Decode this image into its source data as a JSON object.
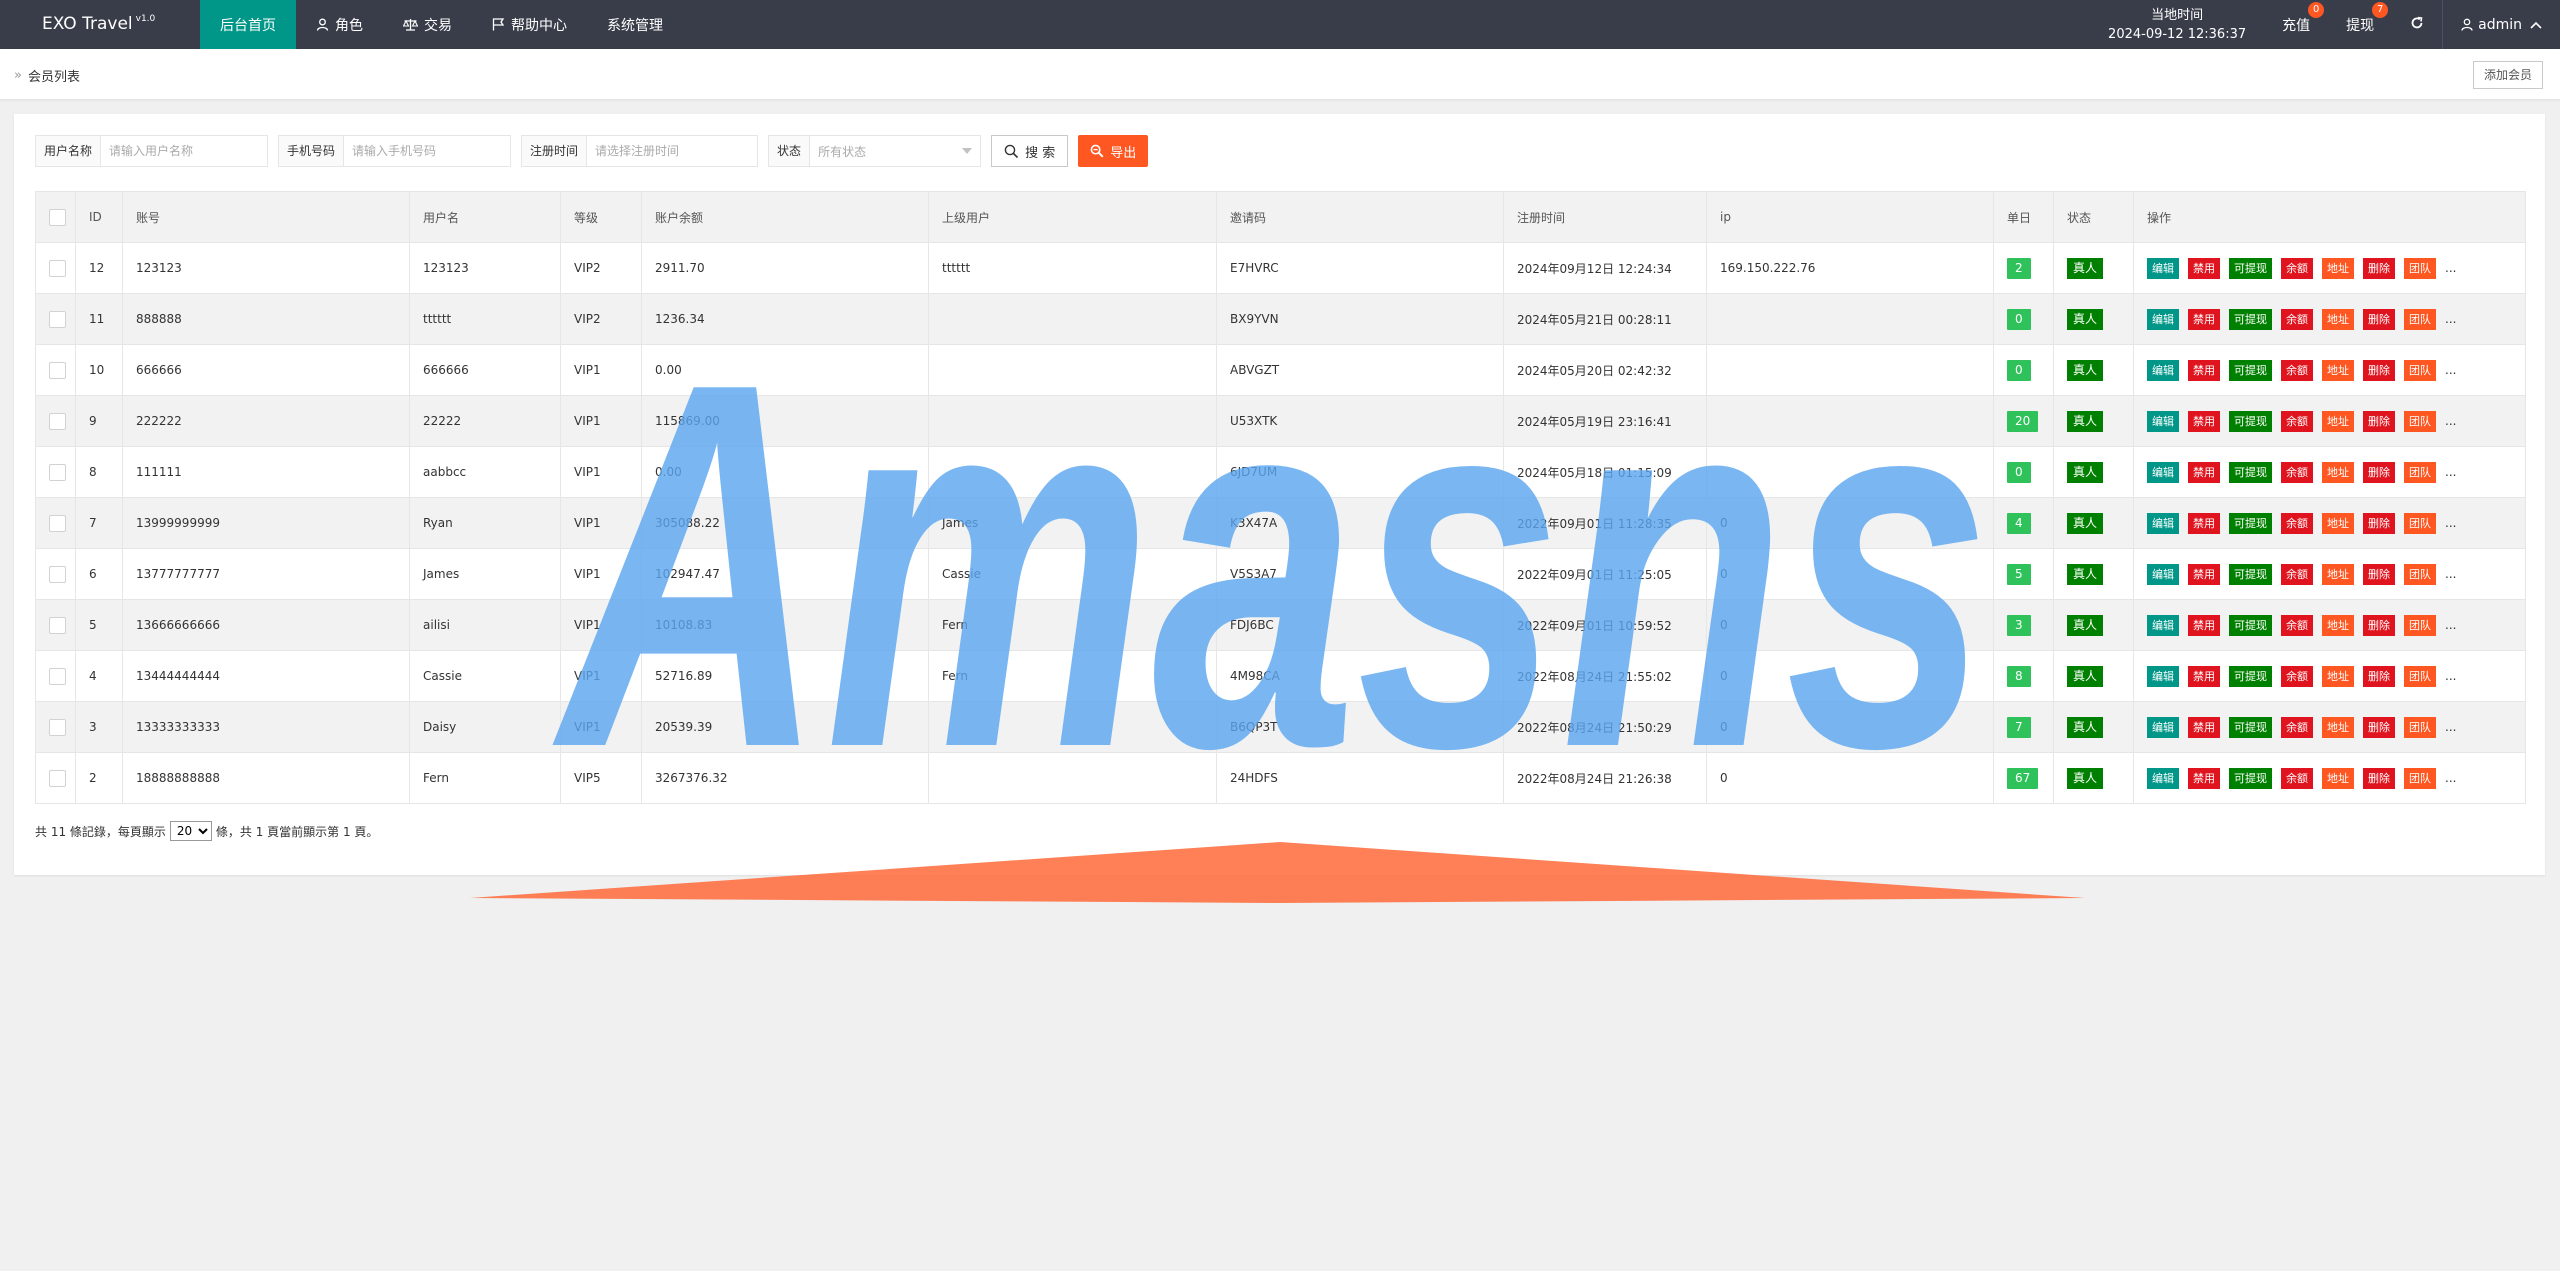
{
  "app": {
    "title": "EXO Travel",
    "version": "v1.0"
  },
  "nav": [
    {
      "label": "后台首页",
      "icon": "",
      "active": true
    },
    {
      "label": "角色",
      "icon": "user-icon"
    },
    {
      "label": "交易",
      "icon": "scale-icon"
    },
    {
      "label": "帮助中心",
      "icon": "flag-icon"
    },
    {
      "label": "系统管理",
      "icon": ""
    }
  ],
  "header_right": {
    "clock_label": "当地时间",
    "clock_value": "2024-09-12 12:36:37",
    "recharge_label": "充值",
    "recharge_count": "0",
    "withdraw_label": "提现",
    "withdraw_count": "7",
    "user_name": "admin"
  },
  "breadcrumb": {
    "label": "会员列表"
  },
  "add_member_label": "添加会员",
  "filters": {
    "username_label": "用户名称",
    "username_placeholder": "请输入用户名称",
    "phone_label": "手机号码",
    "phone_placeholder": "请输入手机号码",
    "regtime_label": "注册时间",
    "regtime_placeholder": "请选择注册时间",
    "status_label": "状态",
    "status_value": "所有状态",
    "search_label": "搜 索",
    "export_label": "导出"
  },
  "table": {
    "headers": [
      "ID",
      "账号",
      "用户名",
      "等级",
      "账户余额",
      "上级用户",
      "邀请码",
      "注册时间",
      "ip",
      "单日",
      "状态",
      "操作"
    ],
    "op_labels": [
      "编辑",
      "禁用",
      "可提现",
      "余额",
      "地址",
      "删除",
      "团队",
      "..."
    ],
    "rows": [
      {
        "id": "12",
        "account": "123123",
        "username": "123123",
        "level": "VIP2",
        "balance": "2911.70",
        "parent": "tttttt",
        "invite": "E7HVRC",
        "regtime": "2024年09月12日 12:24:34",
        "ip": "169.150.222.76",
        "daily": "2",
        "status": "真人"
      },
      {
        "id": "11",
        "account": "888888",
        "username": "tttttt",
        "level": "VIP2",
        "balance": "1236.34",
        "parent": "",
        "invite": "BX9YVN",
        "regtime": "2024年05月21日 00:28:11",
        "ip": "",
        "daily": "0",
        "status": "真人"
      },
      {
        "id": "10",
        "account": "666666",
        "username": "666666",
        "level": "VIP1",
        "balance": "0.00",
        "parent": "",
        "invite": "ABVGZT",
        "regtime": "2024年05月20日 02:42:32",
        "ip": "",
        "daily": "0",
        "status": "真人"
      },
      {
        "id": "9",
        "account": "222222",
        "username": "22222",
        "level": "VIP1",
        "balance": "115869.00",
        "parent": "",
        "invite": "U53XTK",
        "regtime": "2024年05月19日 23:16:41",
        "ip": "",
        "daily": "20",
        "status": "真人"
      },
      {
        "id": "8",
        "account": "111111",
        "username": "aabbcc",
        "level": "VIP1",
        "balance": "0.00",
        "parent": "",
        "invite": "6JD7UM",
        "regtime": "2024年05月18日 01:15:09",
        "ip": "",
        "daily": "0",
        "status": "真人"
      },
      {
        "id": "7",
        "account": "13999999999",
        "username": "Ryan",
        "level": "VIP1",
        "balance": "305088.22",
        "parent": "James",
        "invite": "K3X47A",
        "regtime": "2022年09月01日 11:28:35",
        "ip": "0",
        "daily": "4",
        "status": "真人"
      },
      {
        "id": "6",
        "account": "13777777777",
        "username": "James",
        "level": "VIP1",
        "balance": "102947.47",
        "parent": "Cassie",
        "invite": "V5S3A7",
        "regtime": "2022年09月01日 11:25:05",
        "ip": "0",
        "daily": "5",
        "status": "真人"
      },
      {
        "id": "5",
        "account": "13666666666",
        "username": "ailisi",
        "level": "VIP1",
        "balance": "10108.83",
        "parent": "Fern",
        "invite": "FDJ6BC",
        "regtime": "2022年09月01日 10:59:52",
        "ip": "0",
        "daily": "3",
        "status": "真人"
      },
      {
        "id": "4",
        "account": "13444444444",
        "username": "Cassie",
        "level": "VIP1",
        "balance": "52716.89",
        "parent": "Fern",
        "invite": "4M98CA",
        "regtime": "2022年08月24日 21:55:02",
        "ip": "0",
        "daily": "8",
        "status": "真人"
      },
      {
        "id": "3",
        "account": "13333333333",
        "username": "Daisy",
        "level": "VIP1",
        "balance": "20539.39",
        "parent": "",
        "invite": "B6QP3T",
        "regtime": "2022年08月24日 21:50:29",
        "ip": "0",
        "daily": "7",
        "status": "真人"
      },
      {
        "id": "2",
        "account": "18888888888",
        "username": "Fern",
        "level": "VIP5",
        "balance": "3267376.32",
        "parent": "",
        "invite": "24HDFS",
        "regtime": "2022年08月24日 21:26:38",
        "ip": "0",
        "daily": "67",
        "status": "真人"
      }
    ]
  },
  "pagination": {
    "text_before": "共 11 條記錄，每頁顯示",
    "page_size": "20",
    "text_after": "條，共 1 頁當前顯示第 1 頁。"
  },
  "watermark": {
    "text": "Amasns",
    "color": "#5aa6f0",
    "accent": "#ff6a3a"
  },
  "colors": {
    "nav_bg": "#393D49",
    "teal": "#009688",
    "orange": "#FF5722",
    "red": "#e0141e",
    "green": "#008000"
  }
}
